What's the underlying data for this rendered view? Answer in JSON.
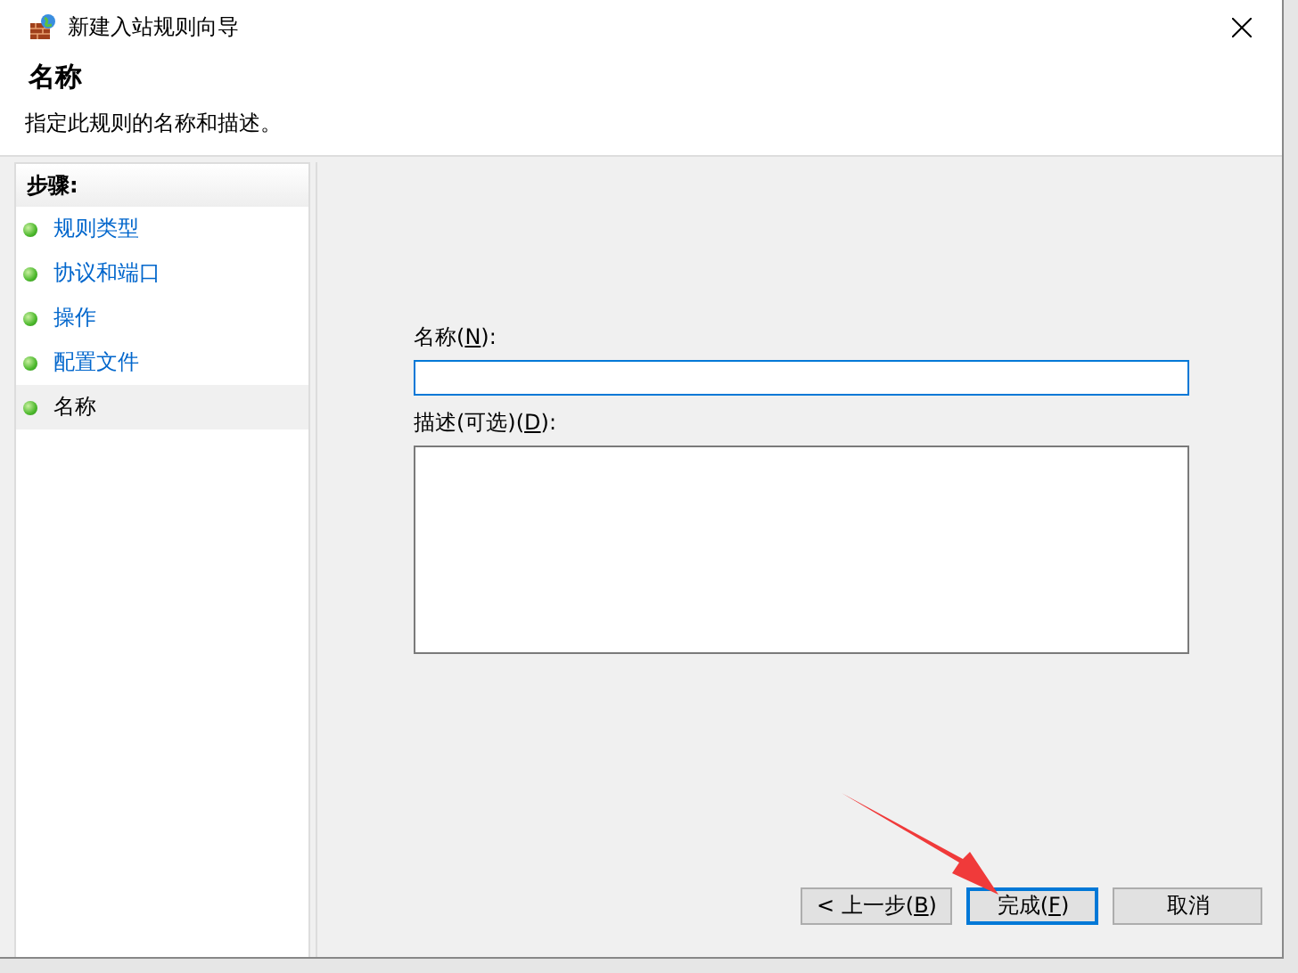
{
  "window": {
    "title": "新建入站规则向导"
  },
  "header": {
    "title": "名称",
    "subtitle": "指定此规则的名称和描述。"
  },
  "steps": {
    "title": "步骤:",
    "items": [
      {
        "label": "规则类型",
        "selected": false
      },
      {
        "label": "协议和端口",
        "selected": false
      },
      {
        "label": "操作",
        "selected": false
      },
      {
        "label": "配置文件",
        "selected": false
      },
      {
        "label": "名称",
        "selected": true
      }
    ]
  },
  "form": {
    "name_label": [
      "名称(",
      "N",
      "):"
    ],
    "description_label": [
      "描述(可选)(",
      "D",
      "):"
    ]
  },
  "buttons": [
    {
      "label": [
        "< 上一步(",
        "B",
        ")"
      ],
      "default": false
    },
    {
      "label": [
        "完成(",
        "F",
        ")"
      ],
      "default": true
    },
    {
      "label": [
        "取消"
      ],
      "default": false
    }
  ]
}
